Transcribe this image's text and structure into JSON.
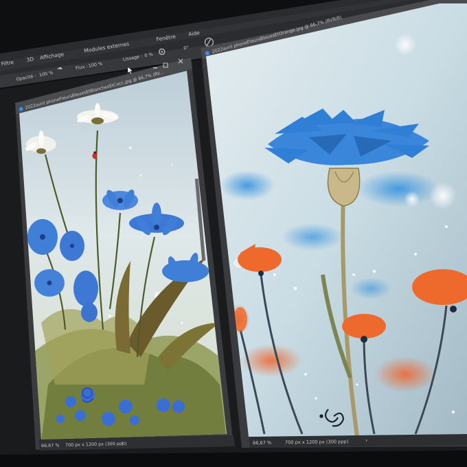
{
  "menu": {
    "items": [
      "Filtre",
      "3D",
      "Affichage",
      "Modules externes",
      "Fenêtre",
      "Aide"
    ]
  },
  "options_bar": {
    "opacity_label": "Opacité :",
    "opacity_value": "100 %",
    "flow_label": "Flux :",
    "flow_value": "100 %",
    "smoothing_label": "Lissage :",
    "smoothing_value": "0 %",
    "angle_value": "0°"
  },
  "doc_left": {
    "tab_title": "2022avril phoneFleursBleuesEtBlanchesEtCocc.jpg @ 66,7% (RV...",
    "zoom": "66,67 %",
    "size_info": "700 px x 1200 px (300 ppp)"
  },
  "doc_right": {
    "tab_title": "2022avril phoneFleursBleuesEtOrange.jpg @ 66,7% (RVB/8)",
    "zoom": "66,67 %",
    "size_info": "700 px x 1200 px (300 ppp)"
  },
  "colors": {
    "monitor_frame": "#111214",
    "ui_panel": "#3a3b3e",
    "cornflower_blue": "#3f7fd8",
    "poppy_orange": "#ee6a2c",
    "sky_left": "#d8e4ea",
    "sky_right": "#c7dbe4"
  }
}
